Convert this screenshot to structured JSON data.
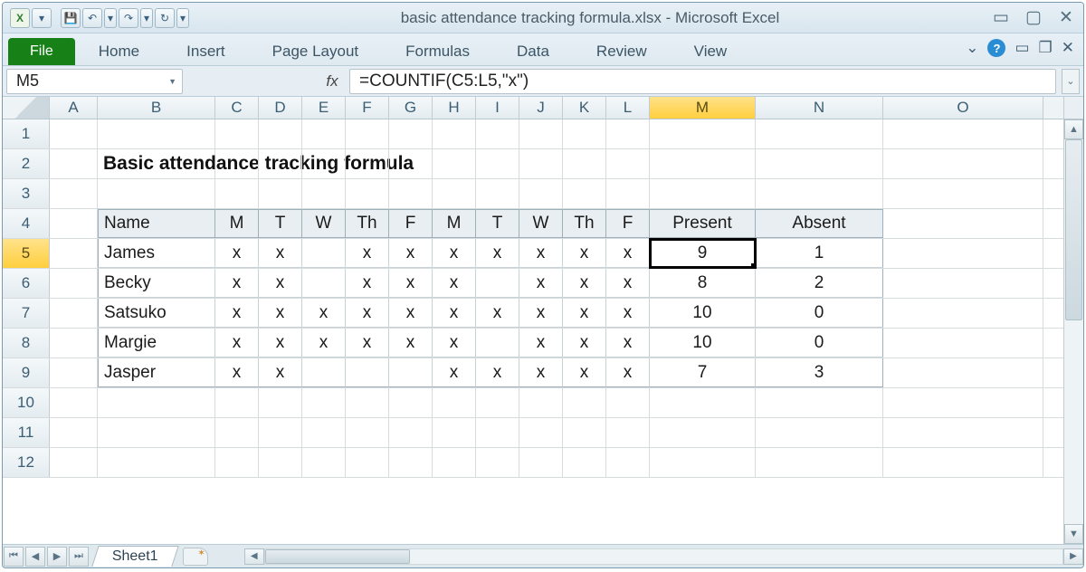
{
  "window": {
    "title": "basic attendance tracking formula.xlsx  -  Microsoft Excel"
  },
  "ribbon": {
    "file": "File",
    "tabs": [
      "Home",
      "Insert",
      "Page Layout",
      "Formulas",
      "Data",
      "Review",
      "View"
    ]
  },
  "namebox": "M5",
  "fx_label": "fx",
  "formula": "=COUNTIF(C5:L5,\"x\")",
  "columns": [
    "A",
    "B",
    "C",
    "D",
    "E",
    "F",
    "G",
    "H",
    "I",
    "J",
    "K",
    "L",
    "M",
    "N",
    "O"
  ],
  "selected_col": "M",
  "selected_row": 5,
  "rows_visible": 12,
  "title_text": "Basic attendance tracking formula",
  "table": {
    "header": [
      "Name",
      "M",
      "T",
      "W",
      "Th",
      "F",
      "M",
      "T",
      "W",
      "Th",
      "F",
      "Present",
      "Absent"
    ],
    "rows": [
      {
        "name": "James",
        "days": [
          "x",
          "x",
          "",
          "x",
          "x",
          "x",
          "x",
          "x",
          "x",
          "x"
        ],
        "present": 9,
        "absent": 1
      },
      {
        "name": "Becky",
        "days": [
          "x",
          "x",
          "",
          "x",
          "x",
          "x",
          "",
          "x",
          "x",
          "x"
        ],
        "present": 8,
        "absent": 2
      },
      {
        "name": "Satsuko",
        "days": [
          "x",
          "x",
          "x",
          "x",
          "x",
          "x",
          "x",
          "x",
          "x",
          "x"
        ],
        "present": 10,
        "absent": 0
      },
      {
        "name": "Margie",
        "days": [
          "x",
          "x",
          "x",
          "x",
          "x",
          "x",
          "",
          "x",
          "x",
          "x"
        ],
        "present": 10,
        "absent": 0
      },
      {
        "name": "Jasper",
        "days": [
          "x",
          "x",
          "",
          "",
          "",
          "x",
          "x",
          "x",
          "x",
          "x"
        ],
        "present": 7,
        "absent": 3
      }
    ]
  },
  "sheet_tab": "Sheet1"
}
